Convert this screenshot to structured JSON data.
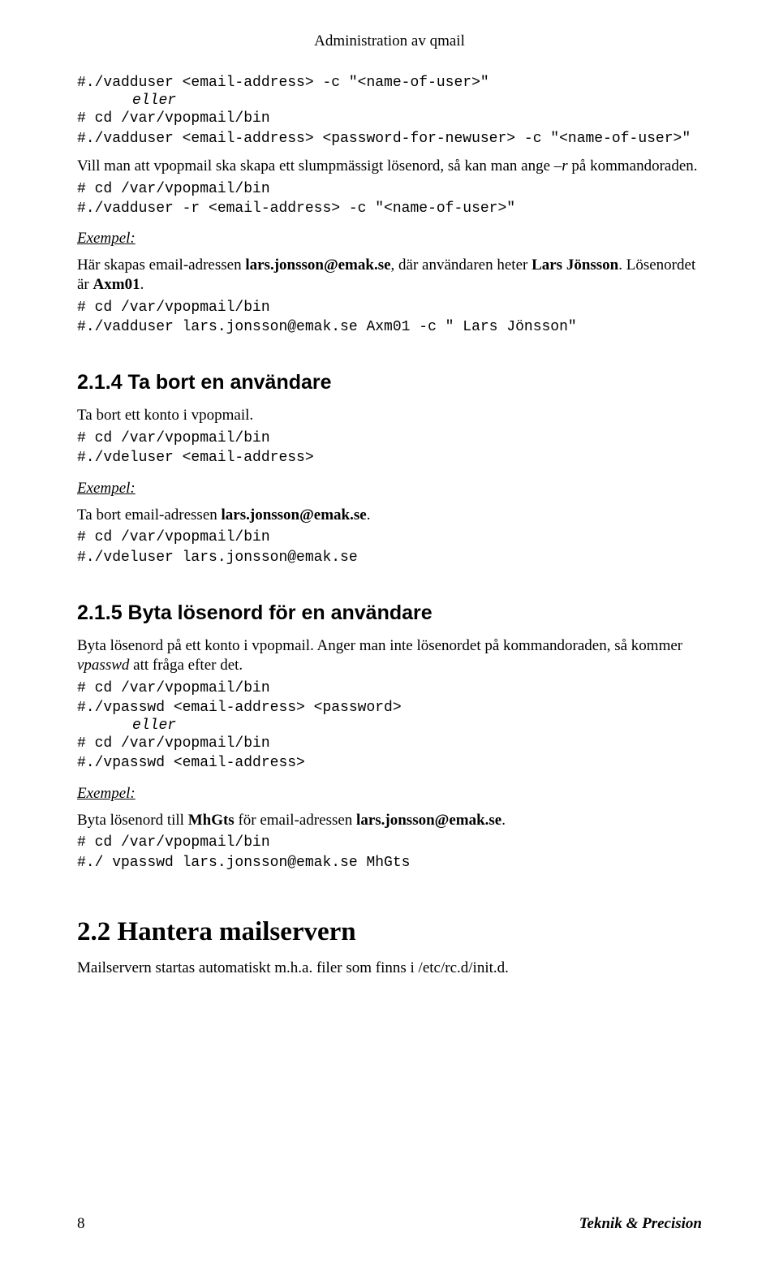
{
  "header": {
    "title": "Administration av qmail"
  },
  "block1": {
    "code1": "#./vadduser <email-address> -c \"<name-of-user>\"",
    "eller": "eller",
    "code2": "# cd /var/vpopmail/bin",
    "code3": "#./vadduser <email-address> <password-for-newuser> -c \"<name-of-user>\""
  },
  "para1": {
    "pre": "Vill man att vpopmail ska skapa ett slumpmässigt lösenord, så kan man ange ",
    "it": "–r",
    "post": " på kommandoraden."
  },
  "block2": {
    "code1": "# cd /var/vpopmail/bin",
    "code2": "#./vadduser -r <email-address> -c \"<name-of-user>\""
  },
  "ex1": {
    "label": "Exempel:",
    "p_pre": "Här skapas email-adressen ",
    "p_b1": "lars.jonsson@emak.se",
    "p_mid": ", där användaren heter ",
    "p_b2": "Lars Jönsson",
    "p_mid2": ". Lösenordet är ",
    "p_b3": "Axm01",
    "p_post": ".",
    "code1": "# cd /var/vpopmail/bin",
    "code2": "#./vadduser lars.jonsson@emak.se Axm01 -c \" Lars Jönsson\""
  },
  "sec214": {
    "heading": "2.1.4 Ta bort en användare",
    "p1": "Ta bort ett konto i vpopmail.",
    "code1": "# cd /var/vpopmail/bin",
    "code2": "#./vdeluser <email-address>",
    "exlabel": "Exempel:",
    "p2_pre": "Ta bort email-adressen ",
    "p2_b": "lars.jonsson@emak.se",
    "p2_post": ".",
    "code3": "# cd /var/vpopmail/bin",
    "code4": "#./vdeluser lars.jonsson@emak.se"
  },
  "sec215": {
    "heading": "2.1.5 Byta lösenord för en användare",
    "p1_pre": "Byta lösenord på ett konto i vpopmail. Anger man inte lösenordet på kommandoraden, så kommer ",
    "p1_it": "vpasswd",
    "p1_post": " att fråga efter det.",
    "code1": "# cd /var/vpopmail/bin",
    "code2": "#./vpasswd <email-address> <password>",
    "eller": "eller",
    "code3": "# cd /var/vpopmail/bin",
    "code4": "#./vpasswd <email-address>",
    "exlabel": "Exempel:",
    "p2_pre": "Byta lösenord till ",
    "p2_b1": "MhGts",
    "p2_mid": " för email-adressen ",
    "p2_b2": "lars.jonsson@emak.se",
    "p2_post": ".",
    "code5": "# cd /var/vpopmail/bin",
    "code6": "#./ vpasswd lars.jonsson@emak.se MhGts"
  },
  "sec22": {
    "heading": "2.2 Hantera mailservern",
    "p1": "Mailservern startas automatiskt m.h.a. filer som finns i /etc/rc.d/init.d."
  },
  "footer": {
    "pagenum": "8",
    "brand": "Teknik & Precision"
  }
}
